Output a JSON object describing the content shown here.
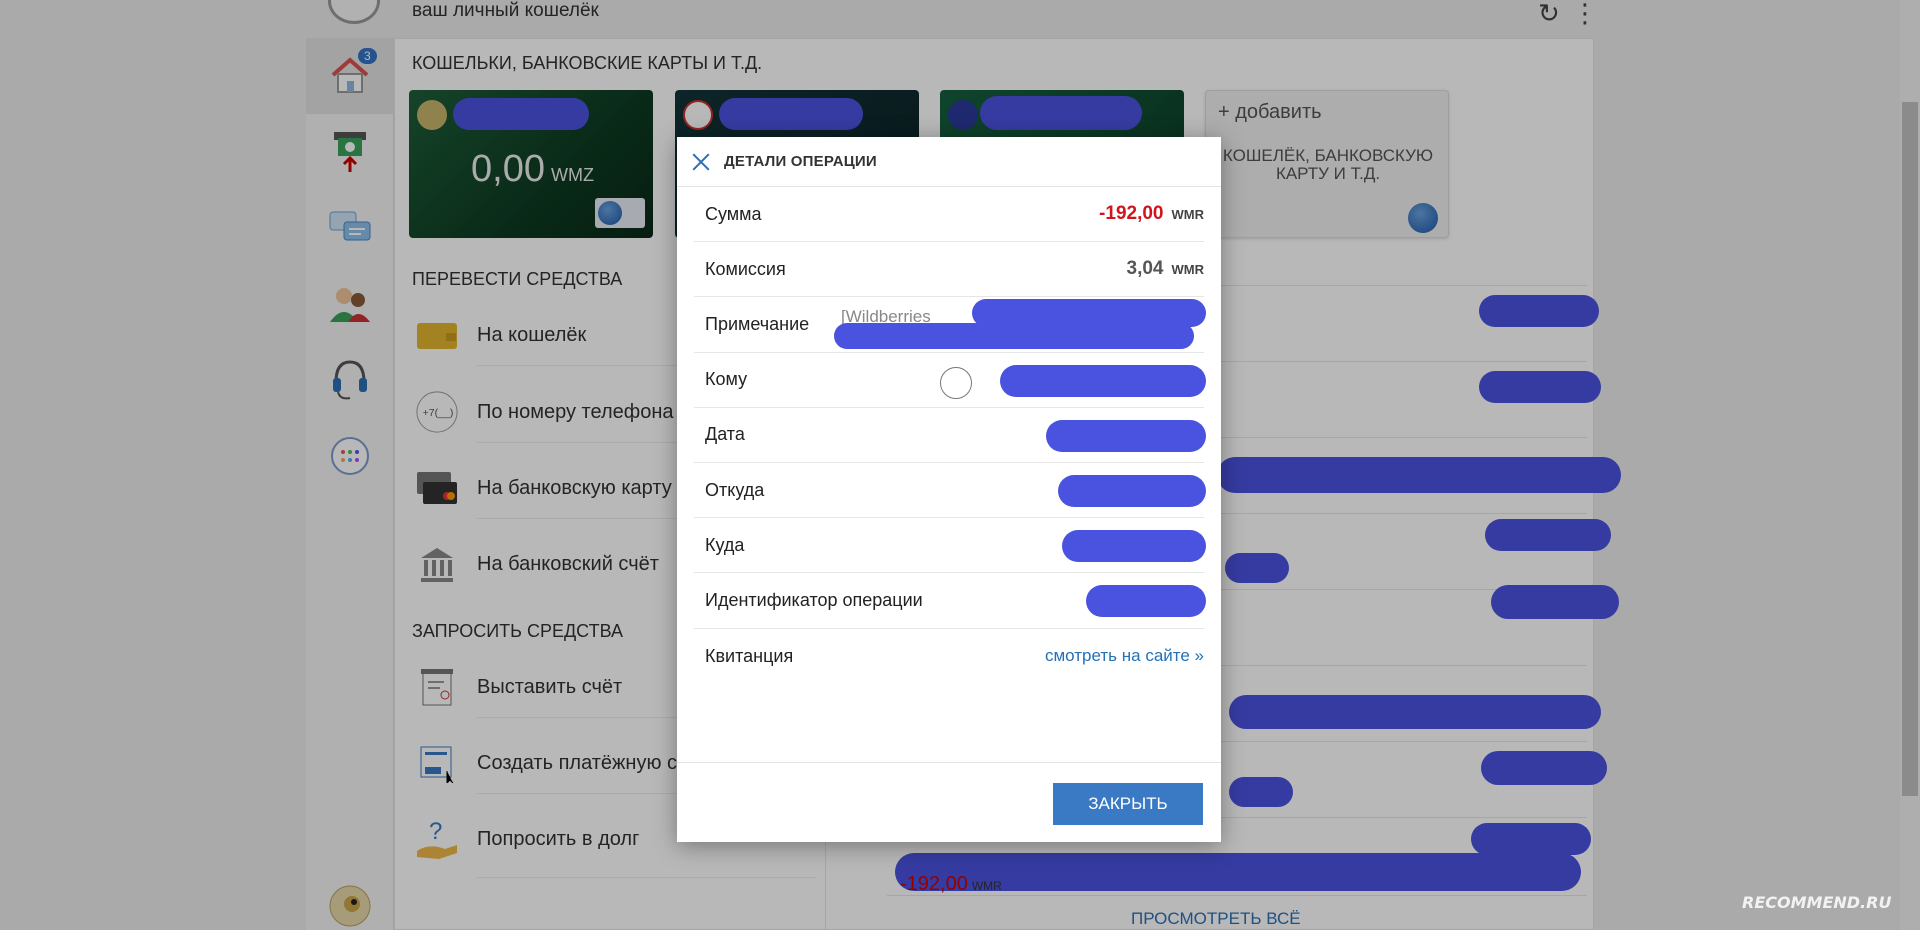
{
  "header": {
    "tagline": "ваш личный кошелёк",
    "refresh_icon": "refresh-icon",
    "more_icon": "more-vertical-icon"
  },
  "sidebar": {
    "items": [
      {
        "icon": "home-icon",
        "badge": "3",
        "active": true
      },
      {
        "icon": "atm-withdraw-icon"
      },
      {
        "icon": "chat-icon"
      },
      {
        "icon": "contacts-icon"
      },
      {
        "icon": "support-headset-icon"
      },
      {
        "icon": "apps-icon"
      }
    ],
    "avatar_icon": "user-avatar-icon"
  },
  "wallets": {
    "title": "КОШЕЛЬКИ, БАНКОВСКИЕ КАРТЫ И Т.Д.",
    "cards": [
      {
        "amount": "0,00",
        "currency": "WMZ"
      },
      {
        "amount": "",
        "currency": ""
      },
      {
        "amount": "",
        "currency": ""
      }
    ],
    "add_label": "добавить",
    "add_sub": "КОШЕЛЁК, БАНКОВСКУЮ КАРТУ И Т.Д."
  },
  "transfer": {
    "title": "ПЕРЕВЕСТИ СРЕДСТВА",
    "items": [
      {
        "label": "На кошелёк",
        "icon": "wallet-icon"
      },
      {
        "label": "По номеру телефона",
        "icon": "phone-number-icon"
      },
      {
        "label": "На банковскую карту",
        "icon": "bank-card-icon"
      },
      {
        "label": "На банковский счёт",
        "icon": "bank-icon"
      }
    ]
  },
  "request": {
    "title": "ЗАПРОСИТЬ СРЕДСТВА",
    "items": [
      {
        "label": "Выставить счёт",
        "icon": "invoice-icon"
      },
      {
        "label": "Создать платёжную с",
        "icon": "pay-page-icon"
      },
      {
        "label": "Попросить в долг",
        "icon": "loan-request-icon"
      }
    ]
  },
  "history": {
    "last_amount": "-192,00",
    "last_currency": "WMR",
    "view_all": "ПРОСМОТРЕТЬ ВСЁ"
  },
  "modal": {
    "title": "ДЕТАЛИ ОПЕРАЦИИ",
    "rows": {
      "amount": {
        "label": "Сумма",
        "value": "-192,00",
        "unit": "WMR"
      },
      "fee": {
        "label": "Комиссия",
        "value": "3,04",
        "unit": "WMR"
      },
      "note": {
        "label": "Примечание",
        "value": "[Wildberries"
      },
      "to": {
        "label": "Кому"
      },
      "date": {
        "label": "Дата"
      },
      "from": {
        "label": "Откуда"
      },
      "dest": {
        "label": "Куда"
      },
      "op_id": {
        "label": "Идентификатор операции"
      },
      "receipt": {
        "label": "Квитанция",
        "link": "смотреть на сайте »"
      }
    },
    "close_button": "ЗАКРЫТЬ"
  },
  "watermark": "RECOMMEND.RU",
  "colors": {
    "accent": "#3a79c4",
    "negative": "#d0151d",
    "redaction": "#4a53e0"
  }
}
